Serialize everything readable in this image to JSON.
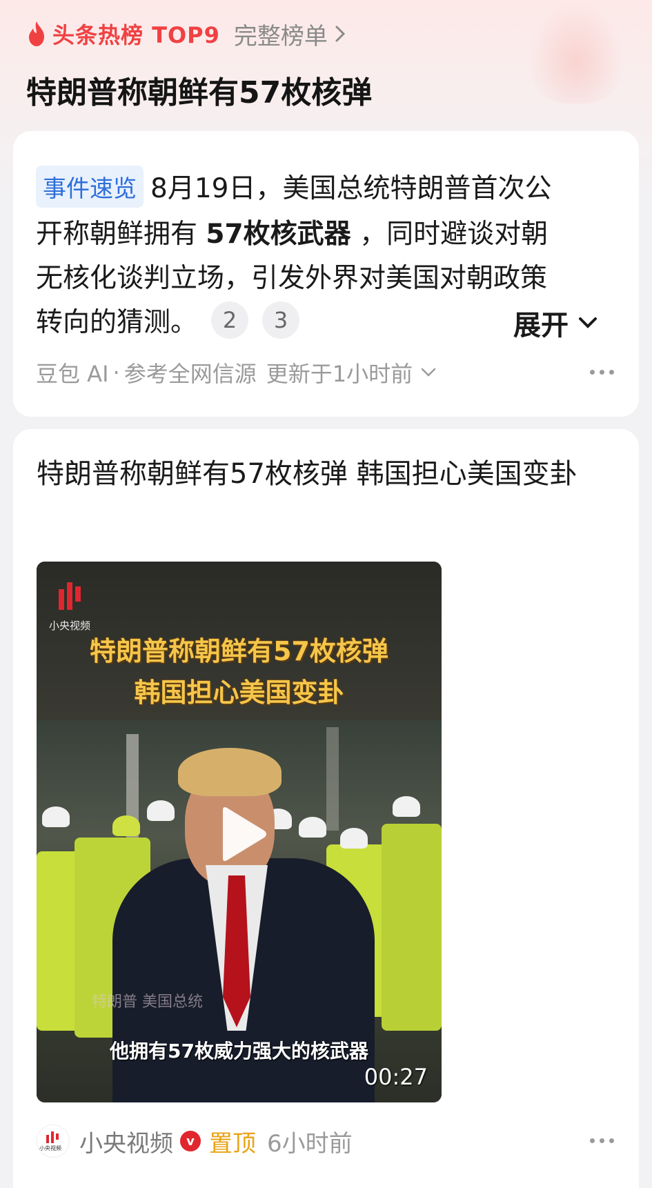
{
  "header": {
    "hotlist_label": "头条热榜 TOP9",
    "full_list_label": "完整榜单",
    "title": "特朗普称朝鲜有57枚核弹",
    "fire_color": "#f04142"
  },
  "summary_card": {
    "tag": "事件速览",
    "line1": "8月19日，美国总统特朗普首次公",
    "line2_a": "开称朝鲜拥有 ",
    "line2_bold": "57枚核武器",
    "line2_b": " ，同时避谈对朝",
    "line3": "无核化谈判立场，引发外界对美国对朝政策",
    "line4": "转向的猜测。",
    "refs": [
      "2",
      "3"
    ],
    "expand_label": "展开",
    "source_label": "豆包 AI",
    "separator": "·",
    "source_desc": "参考全网信源",
    "updated": "更新于1小时前"
  },
  "news_card": {
    "title": "特朗普称朝鲜有57枚核弹 韩国担心美国变卦",
    "video": {
      "logo_text": "小央视频",
      "headline_1": "特朗普称朝鲜有57枚核弹",
      "headline_2": "韩国担心美国变卦",
      "name_caption": "特朗普  美国总统",
      "subtitle": "他拥有57枚威力强大的核武器",
      "duration": "00:27"
    },
    "author": "小央视频",
    "verified_mark": "v",
    "pinned": "置顶",
    "time": "6小时前",
    "avatar_text": "小央视频"
  }
}
